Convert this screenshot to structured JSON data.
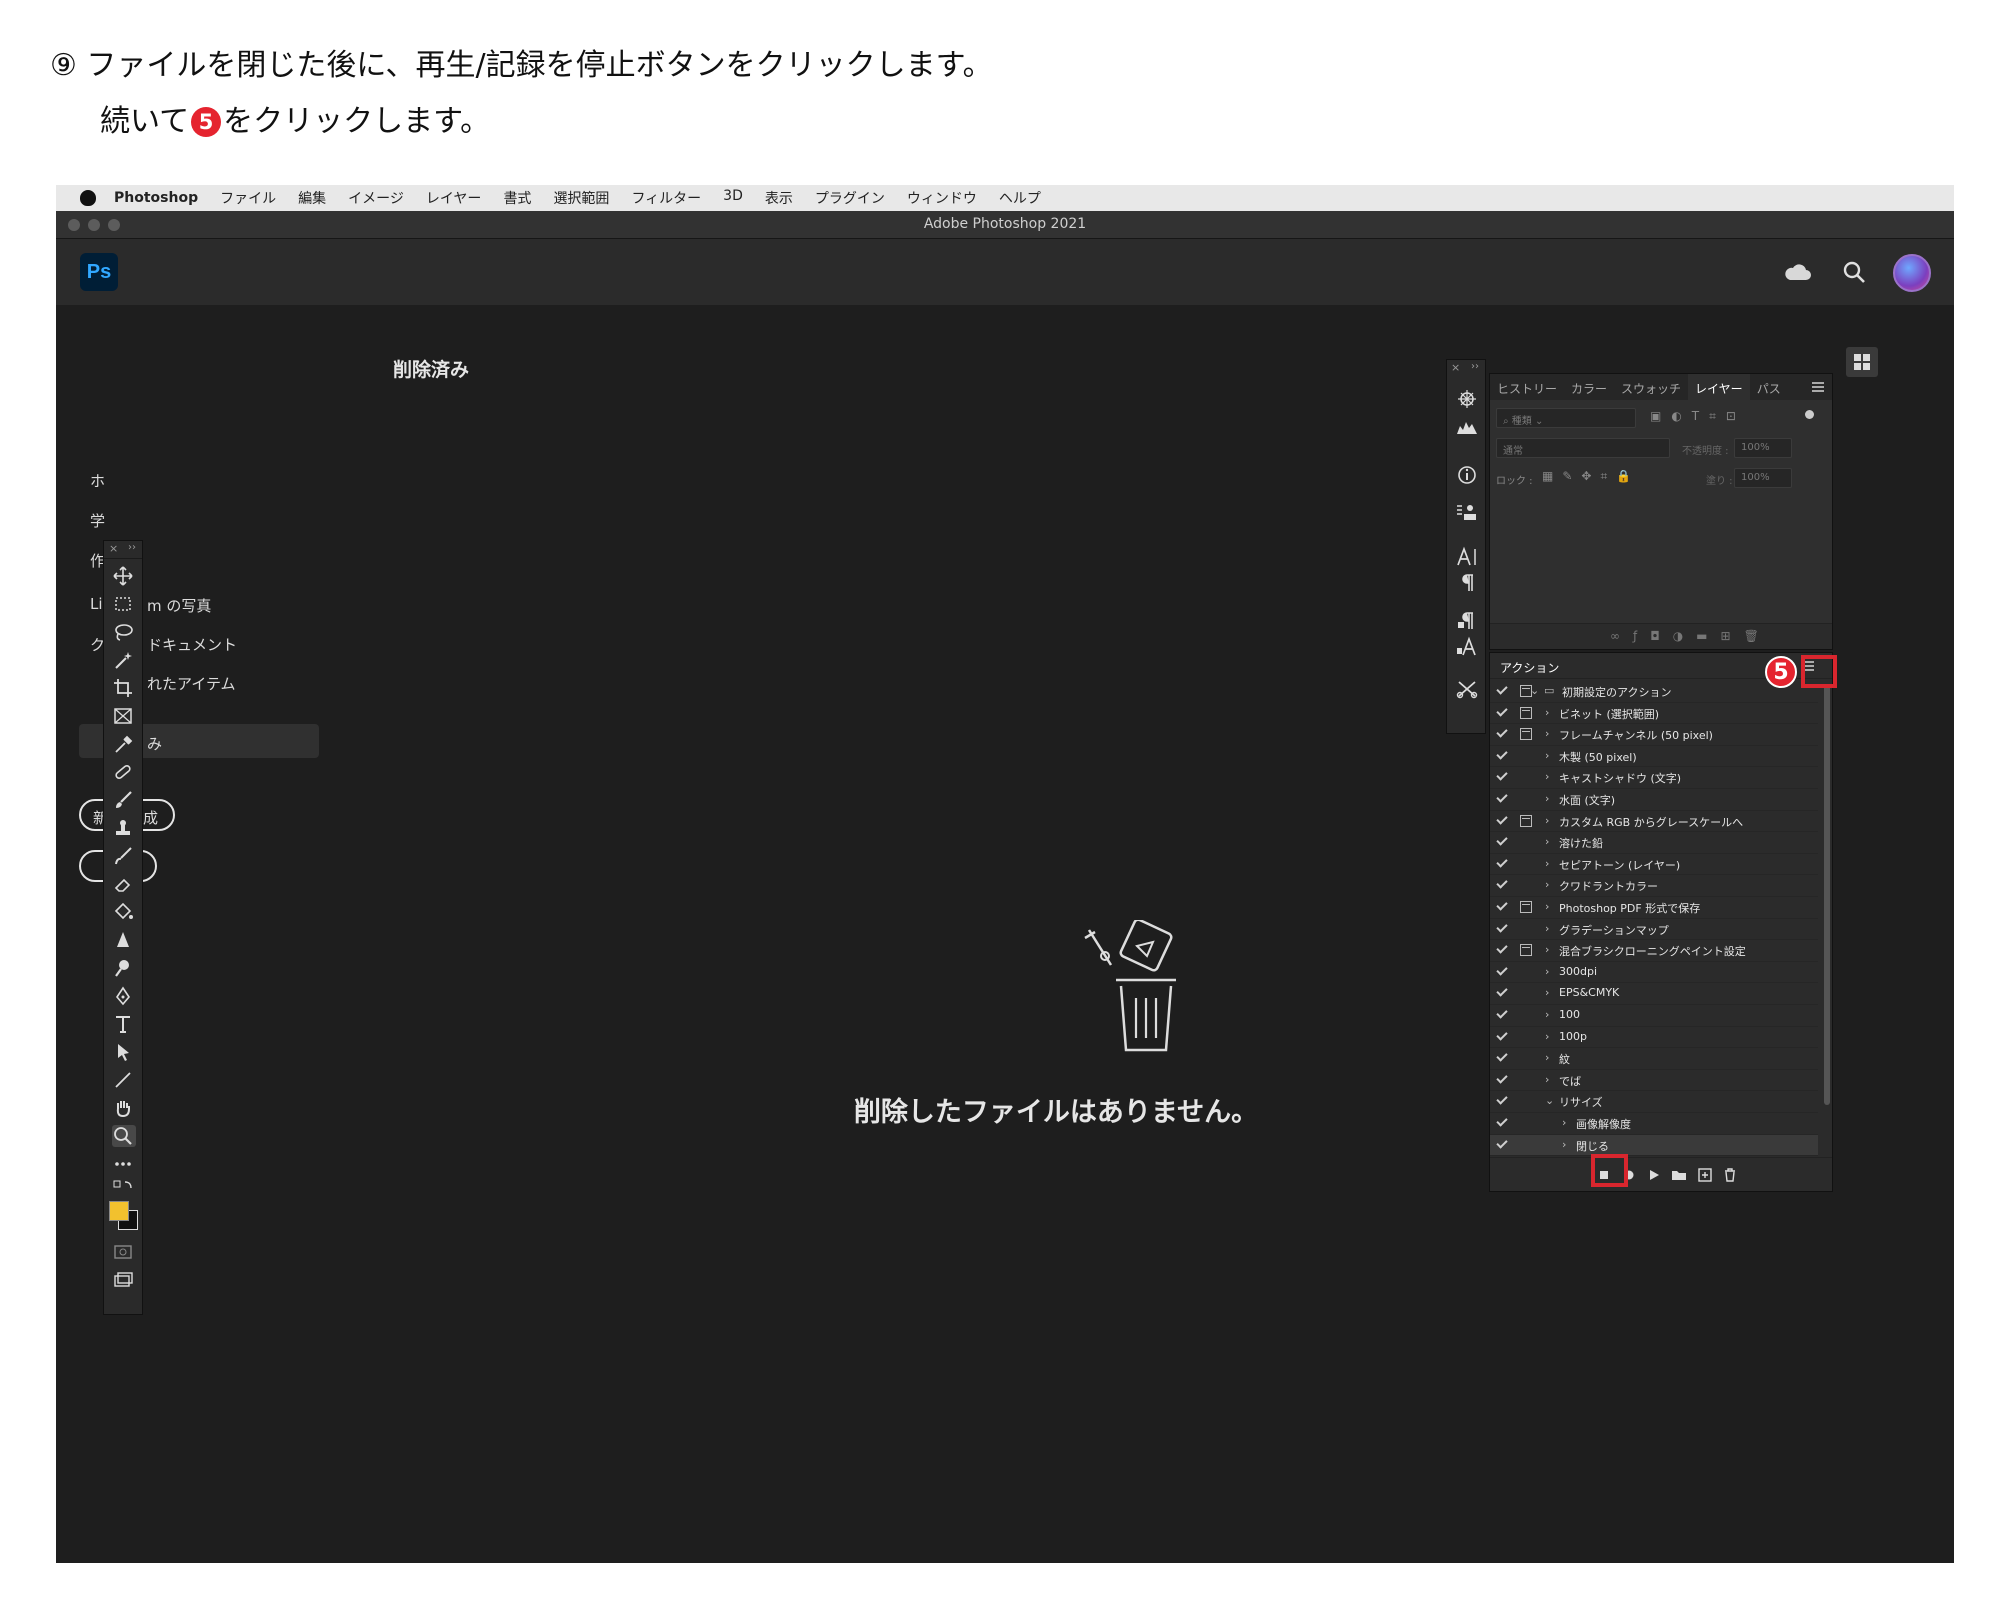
{
  "instruction": {
    "line1": "⑨ ファイルを閉じた後に、再生/記録を停止ボタンをクリックします。",
    "line2_before": "続いて",
    "step_badge": "5",
    "line2_after": "をクリックします。"
  },
  "menubar": {
    "app": "Photoshop",
    "items": [
      "ファイル",
      "編集",
      "イメージ",
      "レイヤー",
      "書式",
      "選択範囲",
      "フィルター",
      "3D",
      "表示",
      "プラグイン",
      "ウィンドウ",
      "ヘルプ"
    ]
  },
  "window": {
    "title": "Adobe Photoshop 2021"
  },
  "header": {
    "logo": "Ps"
  },
  "home_panel": {
    "items": [
      "ホ",
      "学",
      "作",
      "Li",
      "m の写真",
      "ク",
      "ドキュメント",
      "れたアイテム",
      "み"
    ],
    "button1_visible": "新",
    "button1_visible_end": "成"
  },
  "main": {
    "title": "削除済み",
    "empty_message": "削除したファイルはありません。"
  },
  "layers_panel": {
    "tabs": [
      "ヒストリー",
      "カラー",
      "スウォッチ",
      "レイヤー",
      "パス"
    ],
    "active_tab": "レイヤー",
    "filter_placeholder": "種類",
    "blend_mode": "通常",
    "opacity_label": "不透明度 :",
    "opacity_value": "100%",
    "lock_label": "ロック :",
    "fill_label": "塗り :",
    "fill_value": "100%"
  },
  "actions_panel": {
    "title": "アクション",
    "annotation_badge": "5",
    "items": [
      {
        "label": "初期設定のアクション",
        "level": 0,
        "expanded": true,
        "folder": true,
        "dialog": true
      },
      {
        "label": "ビネット (選択範囲)",
        "level": 1,
        "dialog": true
      },
      {
        "label": "フレームチャンネル (50 pixel)",
        "level": 1,
        "dialog": true
      },
      {
        "label": "木製 (50 pixel)",
        "level": 1,
        "dialog": false
      },
      {
        "label": "キャストシャドウ (文字)",
        "level": 1,
        "dialog": false
      },
      {
        "label": "水面 (文字)",
        "level": 1,
        "dialog": false
      },
      {
        "label": "カスタム RGB からグレースケールへ",
        "level": 1,
        "dialog": true
      },
      {
        "label": "溶けた鉛",
        "level": 1,
        "dialog": false
      },
      {
        "label": "セピアトーン (レイヤー)",
        "level": 1,
        "dialog": false
      },
      {
        "label": "クワドラントカラー",
        "level": 1,
        "dialog": false
      },
      {
        "label": "Photoshop PDF 形式で保存",
        "level": 1,
        "dialog": true
      },
      {
        "label": "グラデーションマップ",
        "level": 1,
        "dialog": false
      },
      {
        "label": "混合ブラシクローニングペイント設定",
        "level": 1,
        "dialog": true
      },
      {
        "label": "300dpi",
        "level": 1,
        "dialog": false
      },
      {
        "label": "EPS&CMYK",
        "level": 1,
        "dialog": false
      },
      {
        "label": "100",
        "level": 1,
        "dialog": false
      },
      {
        "label": "100p",
        "level": 1,
        "dialog": false
      },
      {
        "label": "紋",
        "level": 1,
        "dialog": false
      },
      {
        "label": "でば",
        "level": 1,
        "dialog": false
      },
      {
        "label": "リサイズ",
        "level": 1,
        "expanded": true,
        "dialog": false
      },
      {
        "label": "画像解像度",
        "level": 2,
        "dialog": false
      },
      {
        "label": "閉じる",
        "level": 2,
        "dialog": false,
        "selected": true
      }
    ]
  },
  "colors": {
    "highlight": "#d9262e",
    "foreground_swatch": "#f2c12e",
    "background_swatch": "#111111"
  }
}
